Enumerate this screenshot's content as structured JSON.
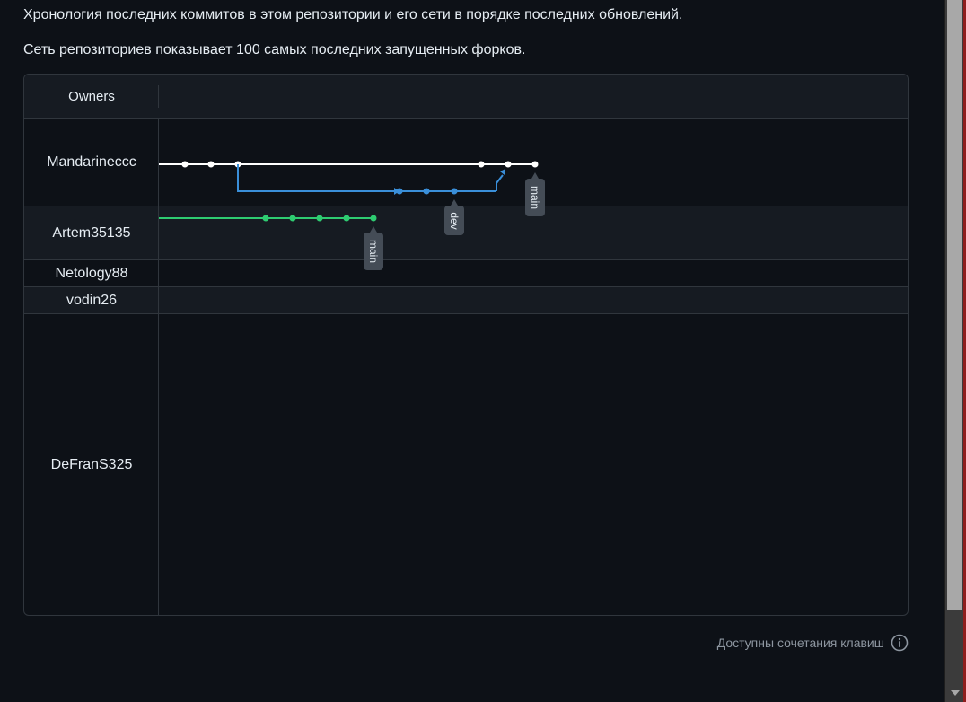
{
  "description": {
    "line1": "Хронология последних коммитов в этом репозитории и его сети в порядке последних обновлений.",
    "line2": "Сеть репозиториев показывает 100 самых последних запущенных форков."
  },
  "network": {
    "owners_header": "Owners",
    "owners": [
      "Mandarineccc",
      "Artem35135",
      "Netology88",
      "vodin26",
      "DeFranS325"
    ],
    "branches": {
      "mandarineccc_main": "main",
      "mandarineccc_dev": "dev",
      "artem_main": "main"
    },
    "colors": {
      "main_line": "#ffffff",
      "dev_line": "#3a8fd9",
      "fork_line": "#2ecc71",
      "label_bg": "#444c56",
      "background": "#0d1117",
      "alt_row": "#161b22",
      "border": "#30363d"
    }
  },
  "footer": {
    "shortcuts_text": "Доступны сочетания клавиш",
    "icon": "info-icon"
  }
}
